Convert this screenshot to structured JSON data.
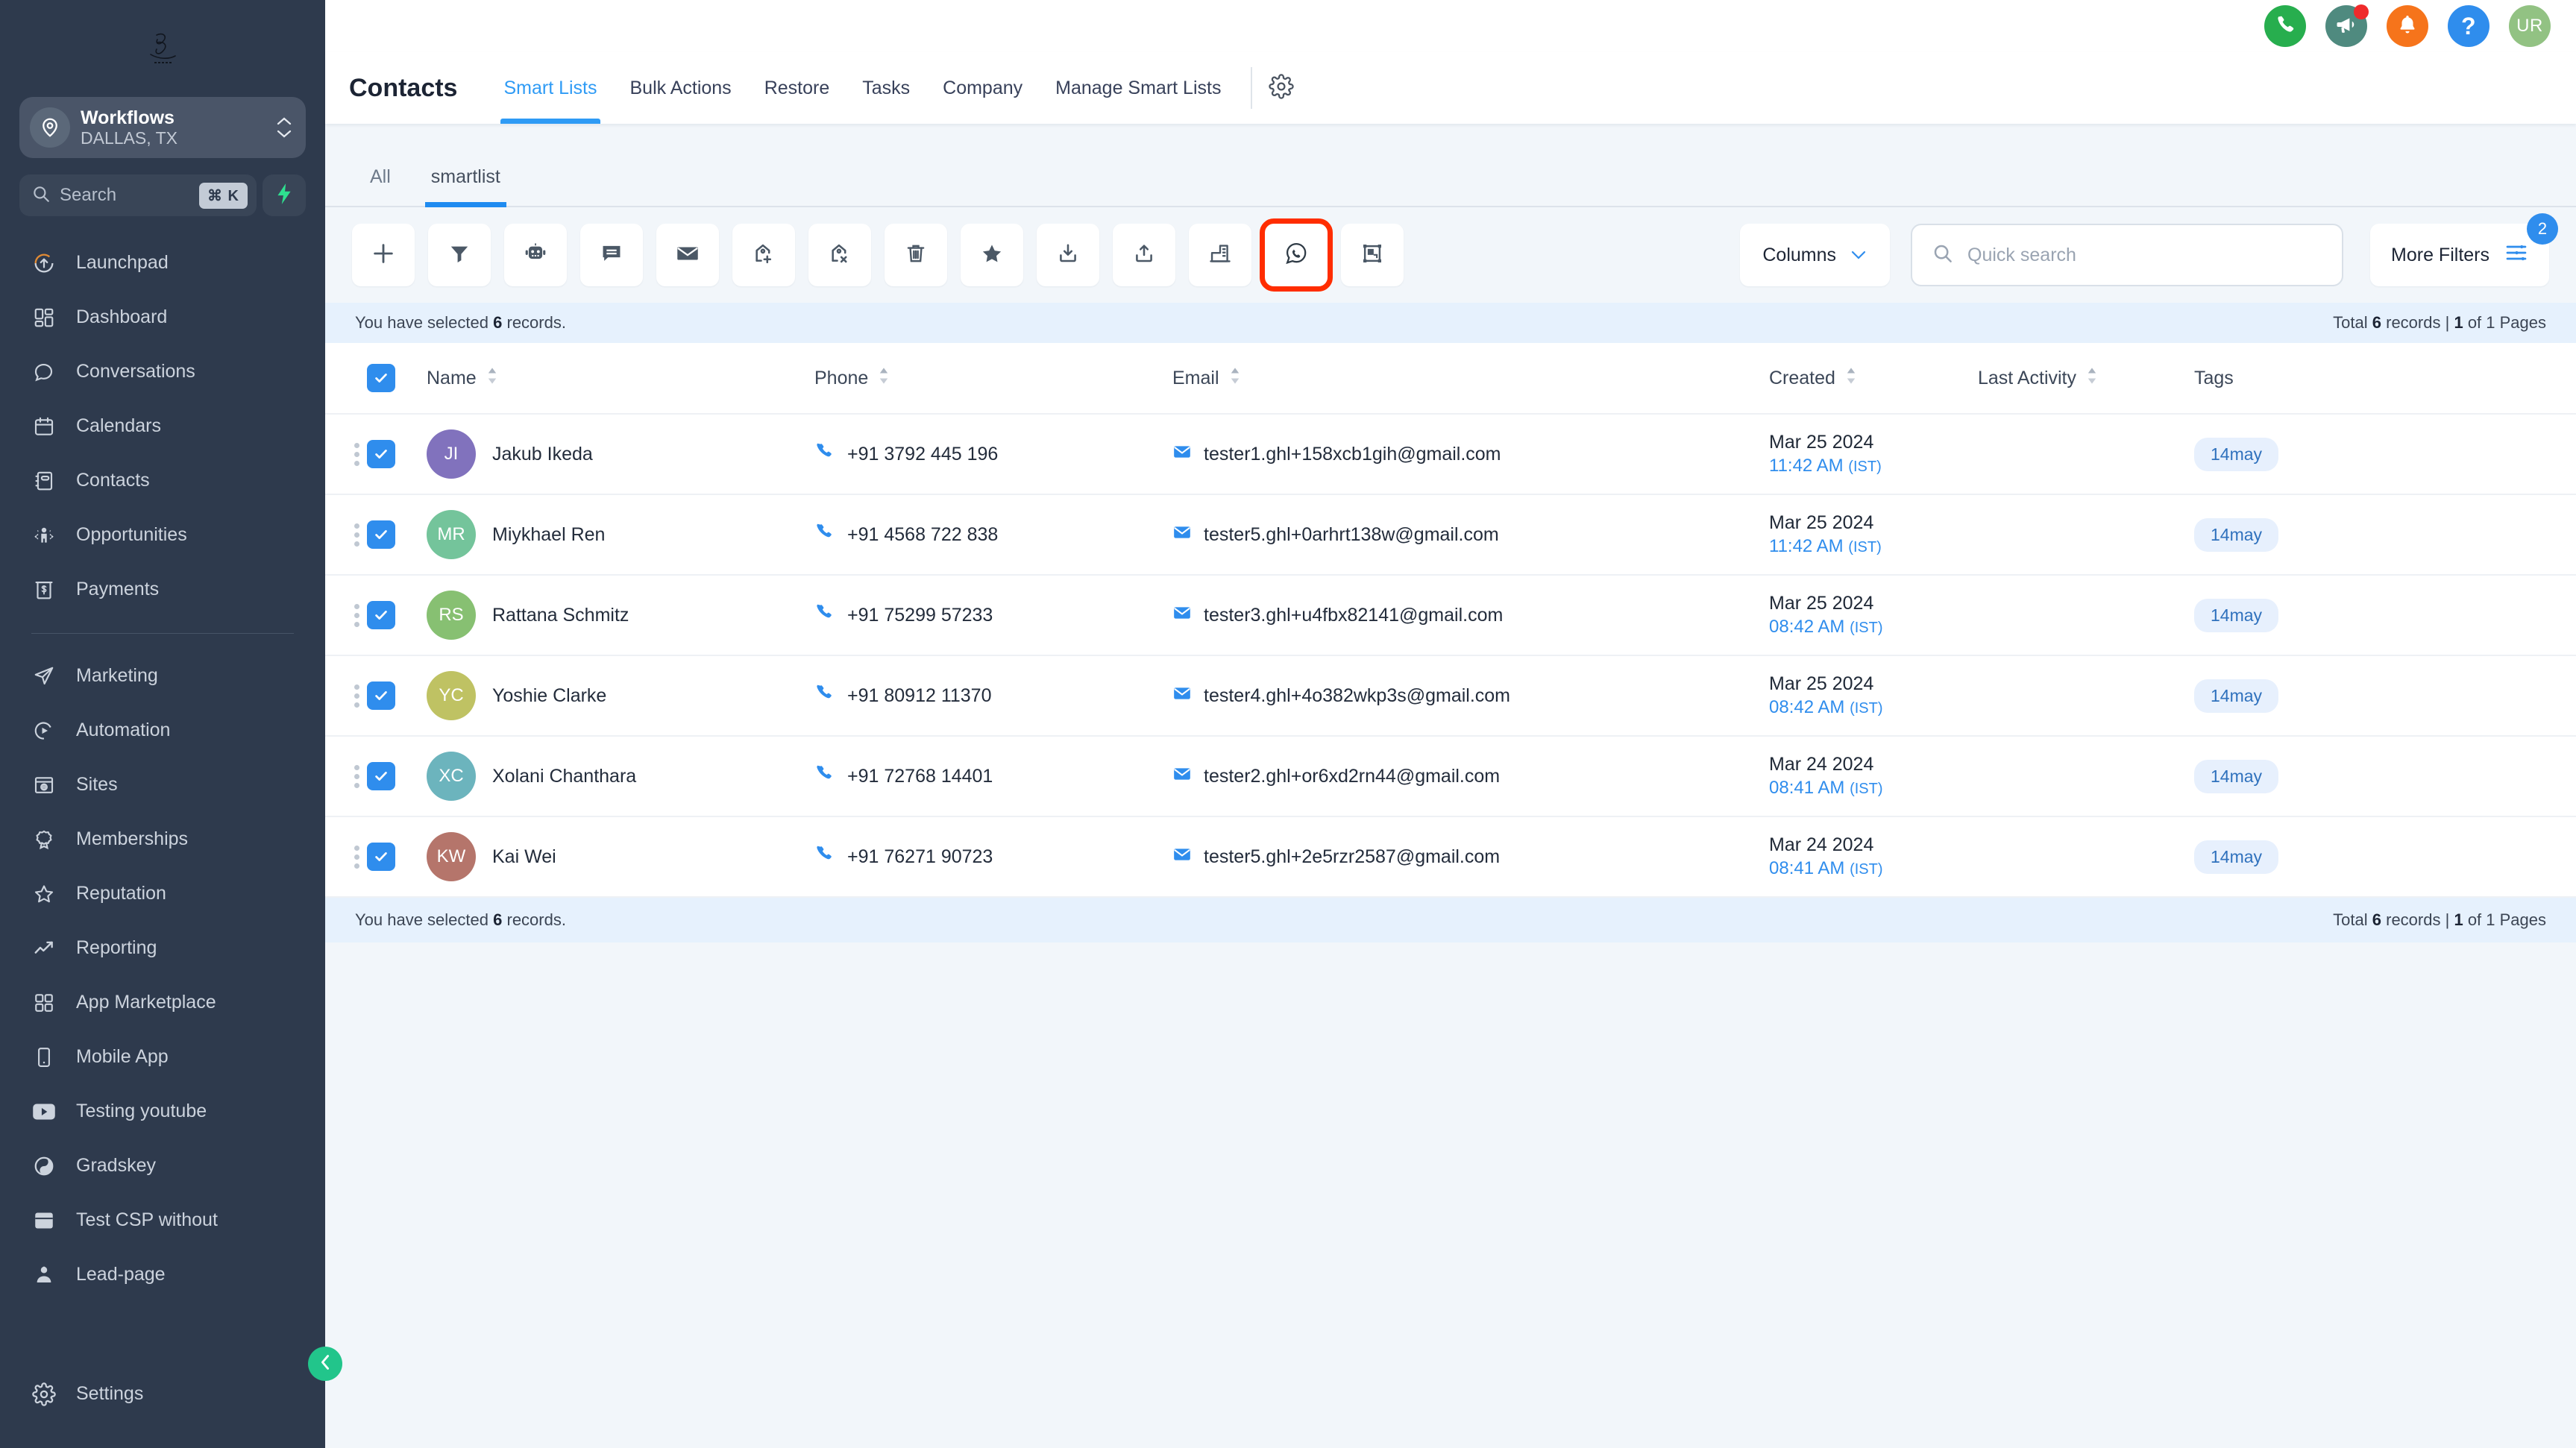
{
  "sidebar": {
    "logo_alt": "brand-signature-logo",
    "location": {
      "name": "Workflows",
      "sub": "DALLAS, TX"
    },
    "search": {
      "placeholder": "Search",
      "shortcut": "⌘ K"
    },
    "items_top": [
      {
        "label": "Launchpad",
        "icon": "rocket-launch-icon"
      },
      {
        "label": "Dashboard",
        "icon": "dashboard-grid-icon"
      },
      {
        "label": "Conversations",
        "icon": "chat-bubble-icon"
      },
      {
        "label": "Calendars",
        "icon": "calendar-icon"
      },
      {
        "label": "Contacts",
        "icon": "contacts-book-icon"
      },
      {
        "label": "Opportunities",
        "icon": "opportunities-icon"
      },
      {
        "label": "Payments",
        "icon": "payments-bill-icon"
      }
    ],
    "items_bottom": [
      {
        "label": "Marketing",
        "icon": "paper-plane-icon"
      },
      {
        "label": "Automation",
        "icon": "play-circle-icon"
      },
      {
        "label": "Sites",
        "icon": "browser-globe-icon"
      },
      {
        "label": "Memberships",
        "icon": "award-badge-icon"
      },
      {
        "label": "Reputation",
        "icon": "star-outline-icon"
      },
      {
        "label": "Reporting",
        "icon": "trend-up-icon"
      },
      {
        "label": "App Marketplace",
        "icon": "apps-grid-icon"
      },
      {
        "label": "Mobile App",
        "icon": "mobile-phone-icon"
      },
      {
        "label": "Testing youtube",
        "icon": "youtube-icon"
      },
      {
        "label": "Gradskey",
        "icon": "yin-yang-icon"
      },
      {
        "label": "Test CSP without",
        "icon": "window-panel-icon"
      },
      {
        "label": "Lead-page",
        "icon": "person-icon"
      }
    ],
    "settings": {
      "label": "Settings",
      "icon": "gear-icon"
    },
    "collapse": {
      "icon": "chevron-left-icon"
    }
  },
  "topbar": {
    "icons": [
      {
        "name": "phone-icon",
        "color": "#27ae4e"
      },
      {
        "name": "megaphone-icon",
        "color": "#4f8a7f",
        "badge": true
      },
      {
        "name": "bell-icon",
        "color": "#f6741b"
      },
      {
        "name": "help-question-icon",
        "color": "#2f8ded"
      }
    ],
    "avatar": {
      "initials": "UR",
      "color": "#92c283"
    }
  },
  "header": {
    "title": "Contacts",
    "tabs": [
      {
        "label": "Smart Lists",
        "active": true
      },
      {
        "label": "Bulk Actions",
        "active": false
      },
      {
        "label": "Restore",
        "active": false
      },
      {
        "label": "Tasks",
        "active": false
      },
      {
        "label": "Company",
        "active": false
      },
      {
        "label": "Manage Smart Lists",
        "active": false
      }
    ],
    "settings_icon": "gear-icon"
  },
  "subtabs": [
    {
      "label": "All",
      "active": false
    },
    {
      "label": "smartlist",
      "active": true
    }
  ],
  "toolbar": {
    "buttons": [
      {
        "name": "add-contact-button",
        "icon": "plus-icon"
      },
      {
        "name": "filter-button",
        "icon": "funnel-icon"
      },
      {
        "name": "bot-button",
        "icon": "robot-icon"
      },
      {
        "name": "sms-button",
        "icon": "message-lines-icon"
      },
      {
        "name": "email-button",
        "icon": "envelope-icon"
      },
      {
        "name": "add-tag-button",
        "icon": "tag-plus-icon"
      },
      {
        "name": "remove-tag-button",
        "icon": "tag-remove-icon"
      },
      {
        "name": "delete-button",
        "icon": "trash-icon"
      },
      {
        "name": "favorite-button",
        "icon": "star-filled-icon"
      },
      {
        "name": "import-button",
        "icon": "download-tray-icon"
      },
      {
        "name": "export-button",
        "icon": "upload-tray-icon"
      },
      {
        "name": "company-button",
        "icon": "building-icon"
      },
      {
        "name": "whatsapp-button",
        "icon": "whatsapp-icon",
        "highlighted": true
      },
      {
        "name": "workflow-button",
        "icon": "workflow-frame-icon"
      }
    ],
    "columns_label": "Columns",
    "columns_chevron": "chevron-down-icon",
    "quick_search_placeholder": "Quick search",
    "quick_search_value": "",
    "more_filters_label": "More Filters",
    "more_filters_badge": "2",
    "highlight_color": "#ff2d00"
  },
  "table": {
    "selection_text_prefix": "You have selected",
    "selection_count": "6",
    "selection_text_suffix": "records.",
    "total_prefix": "Total",
    "total_count": "6",
    "total_mid": "records |",
    "page_current": "1",
    "page_suffix": "of 1 Pages",
    "headers": {
      "name": "Name",
      "phone": "Phone",
      "email": "Email",
      "created": "Created",
      "last_activity": "Last Activity",
      "tags": "Tags"
    },
    "rows": [
      {
        "initials": "JI",
        "avatar_color": "#8172bd",
        "name": "Jakub Ikeda",
        "phone": "+91 3792 445 196",
        "email": "tester1.ghl+158xcb1gih@gmail.com",
        "created_date": "Mar 25 2024",
        "created_time": "11:42 AM",
        "created_tz": "(IST)",
        "last_activity": "",
        "tag": "14may",
        "selected": true
      },
      {
        "initials": "MR",
        "avatar_color": "#74c49b",
        "name": "Miykhael Ren",
        "phone": "+91 4568 722 838",
        "email": "tester5.ghl+0arhrt138w@gmail.com",
        "created_date": "Mar 25 2024",
        "created_time": "11:42 AM",
        "created_tz": "(IST)",
        "last_activity": "",
        "tag": "14may",
        "selected": true
      },
      {
        "initials": "RS",
        "avatar_color": "#87c072",
        "name": "Rattana Schmitz",
        "phone": "+91 75299 57233",
        "email": "tester3.ghl+u4fbx82141@gmail.com",
        "created_date": "Mar 25 2024",
        "created_time": "08:42 AM",
        "created_tz": "(IST)",
        "last_activity": "",
        "tag": "14may",
        "selected": true
      },
      {
        "initials": "YC",
        "avatar_color": "#bfc263",
        "name": "Yoshie Clarke",
        "phone": "+91 80912 11370",
        "email": "tester4.ghl+4o382wkp3s@gmail.com",
        "created_date": "Mar 25 2024",
        "created_time": "08:42 AM",
        "created_tz": "(IST)",
        "last_activity": "",
        "tag": "14may",
        "selected": true
      },
      {
        "initials": "XC",
        "avatar_color": "#6cb4bd",
        "name": "Xolani Chanthara",
        "phone": "+91 72768 14401",
        "email": "tester2.ghl+or6xd2rn44@gmail.com",
        "created_date": "Mar 24 2024",
        "created_time": "08:41 AM",
        "created_tz": "(IST)",
        "last_activity": "",
        "tag": "14may",
        "selected": true
      },
      {
        "initials": "KW",
        "avatar_color": "#b5756b",
        "name": "Kai Wei",
        "phone": "+91 76271 90723",
        "email": "tester5.ghl+2e5rzr2587@gmail.com",
        "created_date": "Mar 24 2024",
        "created_time": "08:41 AM",
        "created_tz": "(IST)",
        "last_activity": "",
        "tag": "14may",
        "selected": true
      }
    ]
  }
}
